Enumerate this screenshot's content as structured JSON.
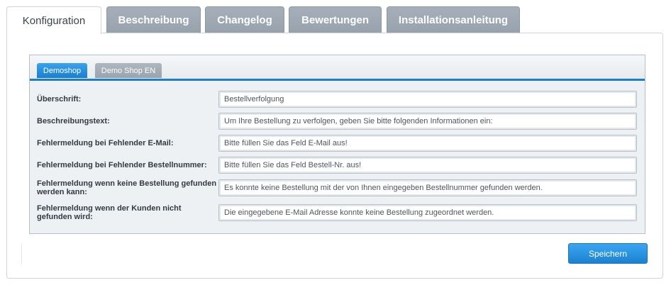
{
  "main_tabs": [
    {
      "label": "Konfiguration",
      "active": true
    },
    {
      "label": "Beschreibung",
      "active": false
    },
    {
      "label": "Changelog",
      "active": false
    },
    {
      "label": "Bewertungen",
      "active": false
    },
    {
      "label": "Installationsanleitung",
      "active": false
    }
  ],
  "shop_tabs": [
    {
      "label": "Demoshop",
      "active": true
    },
    {
      "label": "Demo Shop EN",
      "active": false
    }
  ],
  "fields": [
    {
      "label": "Überschrift:",
      "value": "Bestellverfolgung"
    },
    {
      "label": "Beschreibungstext:",
      "value": "Um Ihre Bestellung zu verfolgen, geben Sie bitte folgenden Informationen ein:"
    },
    {
      "label": "Fehlermeldung bei Fehlender E-Mail:",
      "value": "Bitte füllen Sie das Feld E-Mail aus!"
    },
    {
      "label": "Fehlermeldung bei Fehlender Bestellnummer:",
      "value": "Bitte füllen Sie das Feld Bestell-Nr. aus!"
    },
    {
      "label": "Fehlermeldung wenn keine Bestellung gefunden werden kann:",
      "value": "Es konnte keine Bestellung mit der von Ihnen eingegeben Bestellnummer gefunden werden."
    },
    {
      "label": "Fehlermeldung wenn der Kunden nicht gefunden wird:",
      "value": "Die eingegebene E-Mail Adresse konnte keine Bestellung zugeordnet werden."
    }
  ],
  "actions": {
    "save_label": "Speichern"
  },
  "colors": {
    "accent": "#1b7fce",
    "tab_inactive": "#9ea7b1",
    "panel_bg": "#eef1f4"
  }
}
